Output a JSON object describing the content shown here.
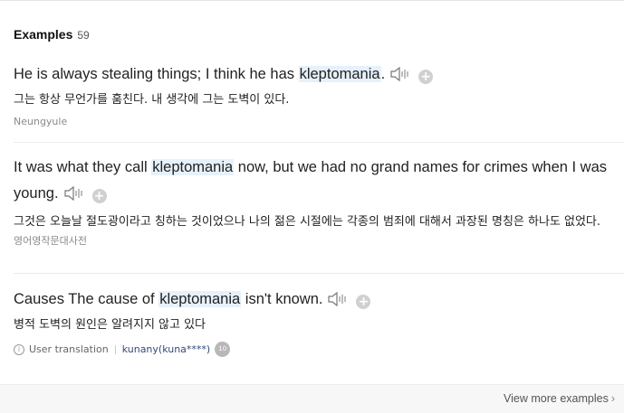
{
  "header": {
    "title": "Examples",
    "count": "59"
  },
  "examples": [
    {
      "pre": "He is always stealing things; I think he has ",
      "keyword": "kleptomania",
      "post": ".",
      "translation": "그는 항상 무언가를 훔친다. 내 생각에 그는 도벽이 있다.",
      "source": "Neungyule"
    },
    {
      "pre": "It was what they call ",
      "keyword": "kleptomania",
      "post": " now, but we had no grand names for crimes when I was young.",
      "translation": "그것은 오늘날 절도광이라고 칭하는 것이었으나 나의 젊은 시절에는 각종의 범죄에 대해서 과장된 명칭은 하나도 없었다.",
      "source": "영어영작문대사전"
    },
    {
      "pre": "Causes The cause of ",
      "keyword": "kleptomania",
      "post": " isn't known.",
      "translation": "병적 도벽의 원인은 알려지지 않고 있다",
      "meta": {
        "label": "User translation",
        "user": "kunany(kuna****)",
        "badge": "10"
      }
    }
  ],
  "icons": {
    "speaker": "speaker-icon",
    "add": "plus-icon",
    "info": "info-icon",
    "chevron": "chevron-right-icon"
  },
  "colors": {
    "highlight": "#e6f1fb",
    "text": "#222222",
    "muted": "#8a8a8a",
    "user": "#334a7a"
  },
  "footer": {
    "view_more": "View more examples"
  }
}
